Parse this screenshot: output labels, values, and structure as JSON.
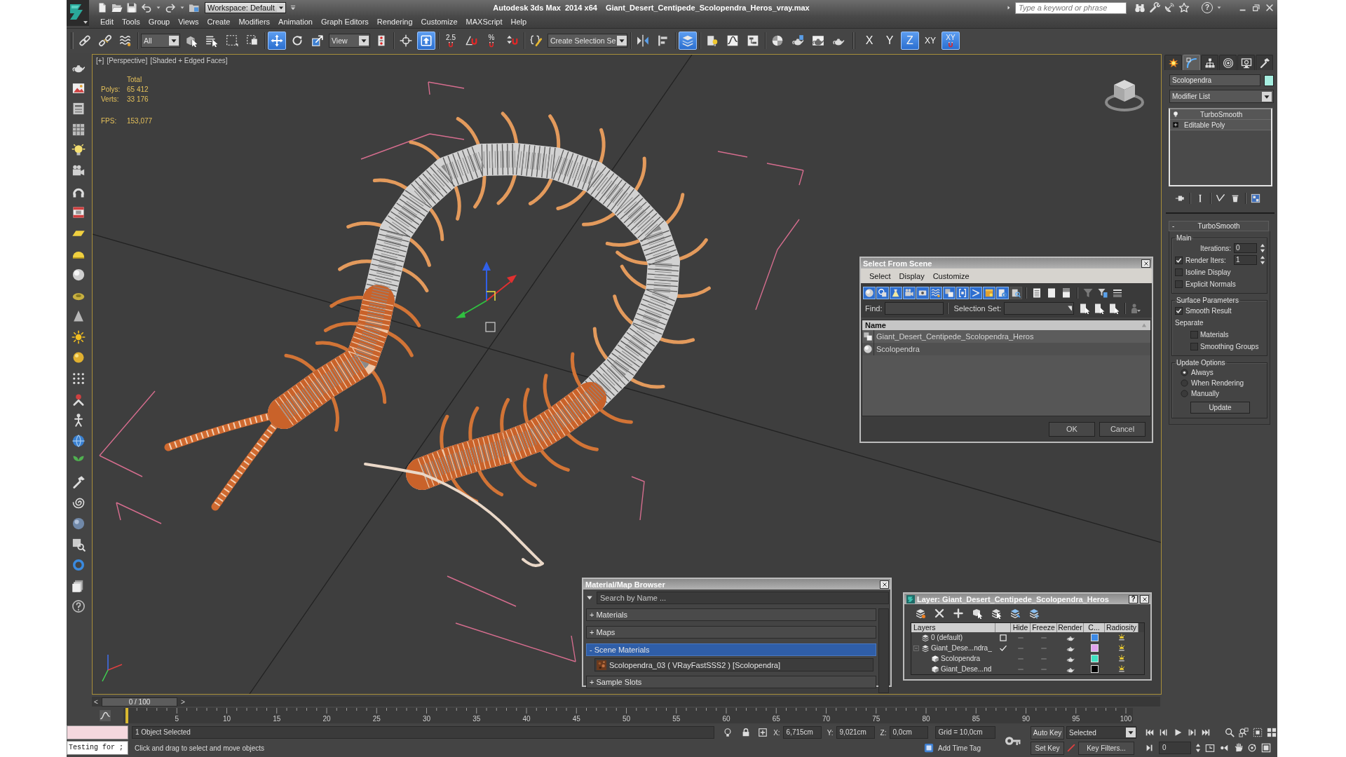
{
  "title_bar": {
    "workspace": "Workspace: Default",
    "app_name": "Autodesk 3ds Max  2014 x64",
    "file_name": "Giant_Desert_Centipede_Scolopendra_Heros_vray.max",
    "search_placeholder": "Type a keyword or phrase",
    "help": "?"
  },
  "menu_bar": [
    "Edit",
    "Tools",
    "Group",
    "Views",
    "Create",
    "Modifiers",
    "Animation",
    "Graph Editors",
    "Rendering",
    "Customize",
    "MAXScript",
    "Help"
  ],
  "main_toolbar": [
    [
      {
        "kind": "tool",
        "selected": false
      },
      {
        "kind": "tool",
        "selected": false
      },
      {
        "kind": "tool",
        "selected": false
      }
    ],
    [
      {
        "kind": "dropdown",
        "value": "All"
      },
      {
        "kind": "tool",
        "selected": false
      },
      {
        "kind": "tool",
        "selected": false
      },
      {
        "kind": "tool",
        "selected": false
      },
      {
        "kind": "tool",
        "selected": false
      }
    ],
    [
      {
        "kind": "tool",
        "selected": true
      },
      {
        "kind": "tool",
        "selected": false
      },
      {
        "kind": "tool",
        "selected": false
      },
      {
        "kind": "dropdown",
        "value": "View"
      },
      {
        "kind": "tool",
        "selected": false
      }
    ],
    [
      {
        "kind": "tool",
        "selected": false
      },
      {
        "kind": "tool",
        "selected": true
      }
    ],
    [
      {
        "kind": "snap",
        "label": "2.5",
        "selected": false
      },
      {
        "kind": "tool",
        "selected": false
      },
      {
        "kind": "snap",
        "label": "%",
        "selected": false
      },
      {
        "kind": "tool",
        "selected": false
      }
    ],
    [
      {
        "kind": "tool",
        "selected": false
      },
      {
        "kind": "dropdown",
        "value": "Create Selection Se"
      }
    ],
    [
      {
        "kind": "tool",
        "selected": false
      },
      {
        "kind": "tool",
        "selected": false
      }
    ],
    [
      {
        "kind": "tool",
        "selected": true
      }
    ],
    [
      {
        "kind": "tool",
        "selected": false
      },
      {
        "kind": "tool",
        "selected": false
      },
      {
        "kind": "tool",
        "selected": false
      }
    ],
    [
      {
        "kind": "tool",
        "selected": false
      },
      {
        "kind": "tool",
        "selected": false
      },
      {
        "kind": "tool",
        "selected": false
      },
      {
        "kind": "tool",
        "selected": false
      }
    ],
    [
      {
        "kind": "axis",
        "label": "X",
        "selected": false
      },
      {
        "kind": "axis",
        "label": "Y",
        "selected": false
      },
      {
        "kind": "axis",
        "label": "Z",
        "selected": true
      },
      {
        "kind": "axis",
        "label": "XY",
        "selected": false
      },
      {
        "kind": "axis_snap",
        "label": "XY",
        "selected": true
      }
    ]
  ],
  "viewport": {
    "labels": [
      "[+]",
      "[Perspective]",
      "[Shaded + Edged Faces]"
    ],
    "stats": {
      "heading": "Total",
      "rows": [
        {
          "label": "Polys:",
          "value": "65 412"
        },
        {
          "label": "Verts:",
          "value": "33 176"
        }
      ],
      "fps_label": "FPS:",
      "fps_value": "153,077"
    }
  },
  "select_from_scene": {
    "title": "Select From Scene",
    "menu": [
      "Select",
      "Display",
      "Customize"
    ],
    "type_filters": [
      {
        "selected": true
      },
      {
        "selected": true
      },
      {
        "selected": true
      },
      {
        "selected": true
      },
      {
        "selected": true
      },
      {
        "selected": true
      },
      {
        "selected": true
      },
      {
        "selected": true
      },
      {
        "selected": true
      },
      {
        "selected": true
      },
      {
        "selected": true
      },
      {
        "selected": false
      }
    ],
    "find_label": "Find:",
    "selection_set_label": "Selection Set:",
    "column": "Name",
    "rows": [
      {
        "kind": "group",
        "name": "Giant_Desert_Centipede_Scolopendra_Heros"
      },
      {
        "kind": "geometry",
        "name": "Scolopendra"
      }
    ],
    "buttons": [
      "OK",
      "Cancel"
    ]
  },
  "material_browser": {
    "title": "Material/Map Browser",
    "search_placeholder": "Search by Name ...",
    "sections": [
      {
        "toggle": "+",
        "label": "Materials",
        "selected": false
      },
      {
        "toggle": "+",
        "label": "Maps",
        "selected": false
      },
      {
        "toggle": "-",
        "label": "Scene Materials",
        "selected": true,
        "items": [
          "Scolopendra_03 ( VRayFastSSS2 ) [Scolopendra]"
        ]
      },
      {
        "toggle": "+",
        "label": "Sample Slots",
        "selected": false
      }
    ]
  },
  "layer_manager": {
    "title": "Layer: Giant_Desert_Centipede_Scolopendra_Heros",
    "help_button": "?",
    "columns": [
      "Layers",
      "Hide",
      "Freeze",
      "Render",
      "C...",
      "Radiosity"
    ],
    "layers": [
      {
        "name": "0 (default)",
        "current": false,
        "hidden": false,
        "frozen": false,
        "renderable": true,
        "color": "#3d8ae6"
      },
      {
        "name": "Giant_Dese...ndra_",
        "current": true,
        "expanded": true,
        "hidden": false,
        "frozen": false,
        "renderable": true,
        "color": "#e2a2ee",
        "children": [
          {
            "name": "Scolopendra",
            "hidden": false,
            "frozen": false,
            "renderable": true,
            "color": "#3fe2c2"
          },
          {
            "name": "Giant_Dese...nd",
            "hidden": false,
            "frozen": false,
            "renderable": true,
            "color": "#000000"
          }
        ]
      }
    ]
  },
  "command_panel": {
    "tabs": [
      {
        "selected": false
      },
      {
        "selected": true
      },
      {
        "selected": false
      },
      {
        "selected": false
      },
      {
        "selected": false
      },
      {
        "selected": false
      }
    ],
    "object_name": "Scolopendra",
    "modifier_list": "Modifier List",
    "stack": [
      {
        "kind": "modifier",
        "name": "TurboSmooth"
      },
      {
        "kind": "base_object",
        "name": "Editable Poly"
      }
    ],
    "rollout": {
      "toggle": "-",
      "title": "TurboSmooth",
      "groups": [
        {
          "title": "Main",
          "controls": [
            {
              "kind": "spinner",
              "label": "Iterations:",
              "value": "0"
            },
            {
              "kind": "check_spinner",
              "label": "Render Iters:",
              "checked": true,
              "value": "1"
            },
            {
              "kind": "checkbox",
              "label": "Isoline Display",
              "checked": false
            },
            {
              "kind": "checkbox",
              "label": "Explicit Normals",
              "checked": false
            }
          ]
        },
        {
          "title": "Surface Parameters",
          "controls": [
            {
              "kind": "checkbox",
              "label": "Smooth Result",
              "checked": true
            },
            {
              "kind": "label",
              "label": "Separate"
            },
            {
              "kind": "sub_checkbox",
              "label": "Materials",
              "checked": false
            },
            {
              "kind": "sub_checkbox",
              "label": "Smoothing Groups",
              "checked": false
            }
          ]
        },
        {
          "title": "Update Options",
          "controls": [
            {
              "kind": "radio",
              "label": "Always",
              "selected": true
            },
            {
              "kind": "radio",
              "label": "When Rendering",
              "selected": false
            },
            {
              "kind": "radio",
              "label": "Manually",
              "selected": false
            },
            {
              "kind": "button",
              "label": "Update"
            }
          ]
        }
      ]
    }
  },
  "time_slider": {
    "back": "<",
    "position": "0 / 100",
    "forward": ">",
    "level": 0
  },
  "track_bar": {
    "labels": [
      "5",
      "10",
      "15",
      "20",
      "25",
      "30",
      "35",
      "40",
      "45",
      "50",
      "55",
      "60",
      "65",
      "70",
      "75",
      "80",
      "85",
      "90",
      "95",
      "100"
    ]
  },
  "status_bar": {
    "script_listener": "Testing for ;",
    "selection": "1 Object Selected",
    "coords": [
      {
        "axis": "X:",
        "value": "6,715cm"
      },
      {
        "axis": "Y:",
        "value": "9,021cm"
      },
      {
        "axis": "Z:",
        "value": "0,0cm"
      }
    ],
    "grid": "Grid = 10,0cm",
    "prompt": "Click and drag to select and move objects",
    "add_time_tag": "Add Time Tag",
    "auto_key": "Auto Key",
    "key_mode": "Selected",
    "set_key": "Set Key",
    "key_filters": "Key Filters...",
    "frame": "0"
  }
}
